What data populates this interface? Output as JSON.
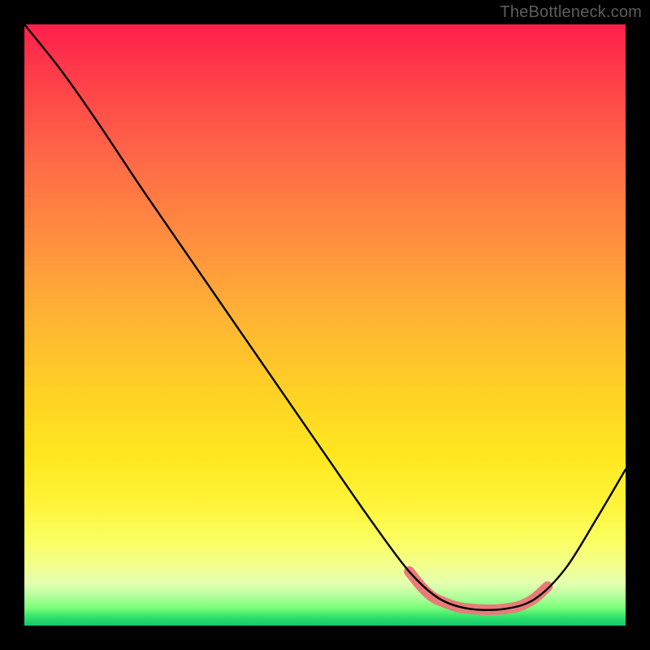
{
  "watermark": "TheBottleneck.com",
  "chart_data": {
    "type": "line",
    "title": "",
    "xlabel": "",
    "ylabel": "",
    "x_range_fraction": [
      0,
      1
    ],
    "y_range_fraction": [
      0,
      1
    ],
    "series": [
      {
        "name": "bottleneck-curve",
        "comment": "Black bottleneck curve. x,y as fractions of plot area (0,0 = top-left).",
        "points": [
          {
            "x": 0.0,
            "y": 0.0
          },
          {
            "x": 0.06,
            "y": 0.075
          },
          {
            "x": 0.12,
            "y": 0.16
          },
          {
            "x": 0.2,
            "y": 0.28
          },
          {
            "x": 0.3,
            "y": 0.425
          },
          {
            "x": 0.4,
            "y": 0.57
          },
          {
            "x": 0.5,
            "y": 0.715
          },
          {
            "x": 0.58,
            "y": 0.83
          },
          {
            "x": 0.64,
            "y": 0.91
          },
          {
            "x": 0.69,
            "y": 0.955
          },
          {
            "x": 0.74,
            "y": 0.972
          },
          {
            "x": 0.8,
            "y": 0.972
          },
          {
            "x": 0.85,
            "y": 0.955
          },
          {
            "x": 0.9,
            "y": 0.905
          },
          {
            "x": 0.95,
            "y": 0.825
          },
          {
            "x": 1.0,
            "y": 0.74
          }
        ]
      },
      {
        "name": "optimal-band",
        "comment": "Salmon highlight band over the valley of the black curve.",
        "color": "#e97b7a",
        "points": [
          {
            "x": 0.64,
            "y": 0.91
          },
          {
            "x": 0.67,
            "y": 0.945
          },
          {
            "x": 0.7,
            "y": 0.962
          },
          {
            "x": 0.74,
            "y": 0.972
          },
          {
            "x": 0.8,
            "y": 0.972
          },
          {
            "x": 0.84,
            "y": 0.96
          },
          {
            "x": 0.87,
            "y": 0.935
          }
        ]
      }
    ]
  }
}
